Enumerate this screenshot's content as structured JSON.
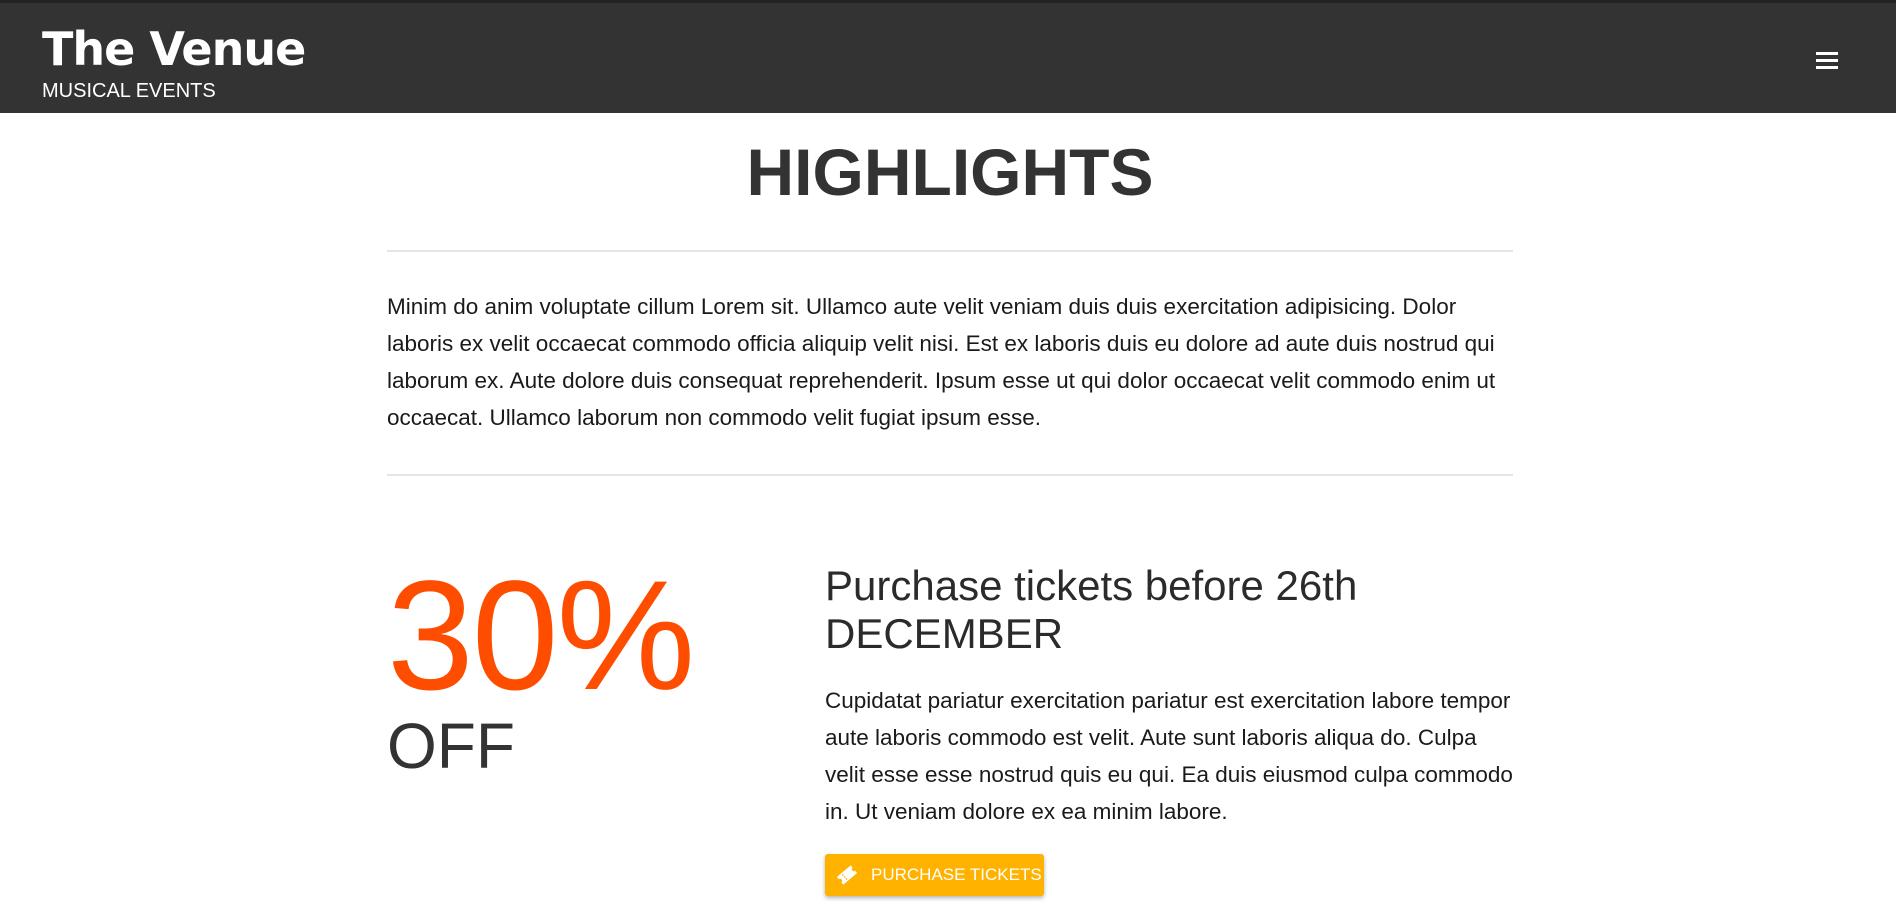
{
  "header": {
    "brand_title": "The Venue",
    "brand_subtitle": "MUSICAL EVENTS",
    "menu_icon": "menu-icon",
    "background": "#333333"
  },
  "highlights": {
    "heading": "HIGHLIGHTS",
    "intro": "Minim do anim voluptate cillum Lorem sit. Ullamco aute velit veniam duis duis exercitation adipisicing. Dolor laboris ex velit occaecat commodo officia aliquip velit nisi. Est ex laboris duis eu dolore ad aute duis nostrud qui laborum ex. Aute dolore duis consequat reprehenderit. Ipsum esse ut qui dolor occaecat velit commodo enim ut occaecat. Ullamco laborum non commodo velit fugiat ipsum esse."
  },
  "offer": {
    "discount": "30%",
    "discount_suffix": "OFF",
    "discount_color": "#ff4d00",
    "title": "Purchase tickets before 26th DECEMBER",
    "text": "Cupidatat pariatur exercitation pariatur est exercitation labore tempor aute laboris commodo est velit. Aute sunt laboris aliqua do. Culpa velit esse esse nostrud quis eu qui. Ea duis eiusmod culpa commodo in. Ut veniam dolore ex ea minim labore.",
    "button_label": "PURCHASE TICKETS",
    "button_icon": "ticket-icon",
    "button_color": "#ffb300"
  }
}
